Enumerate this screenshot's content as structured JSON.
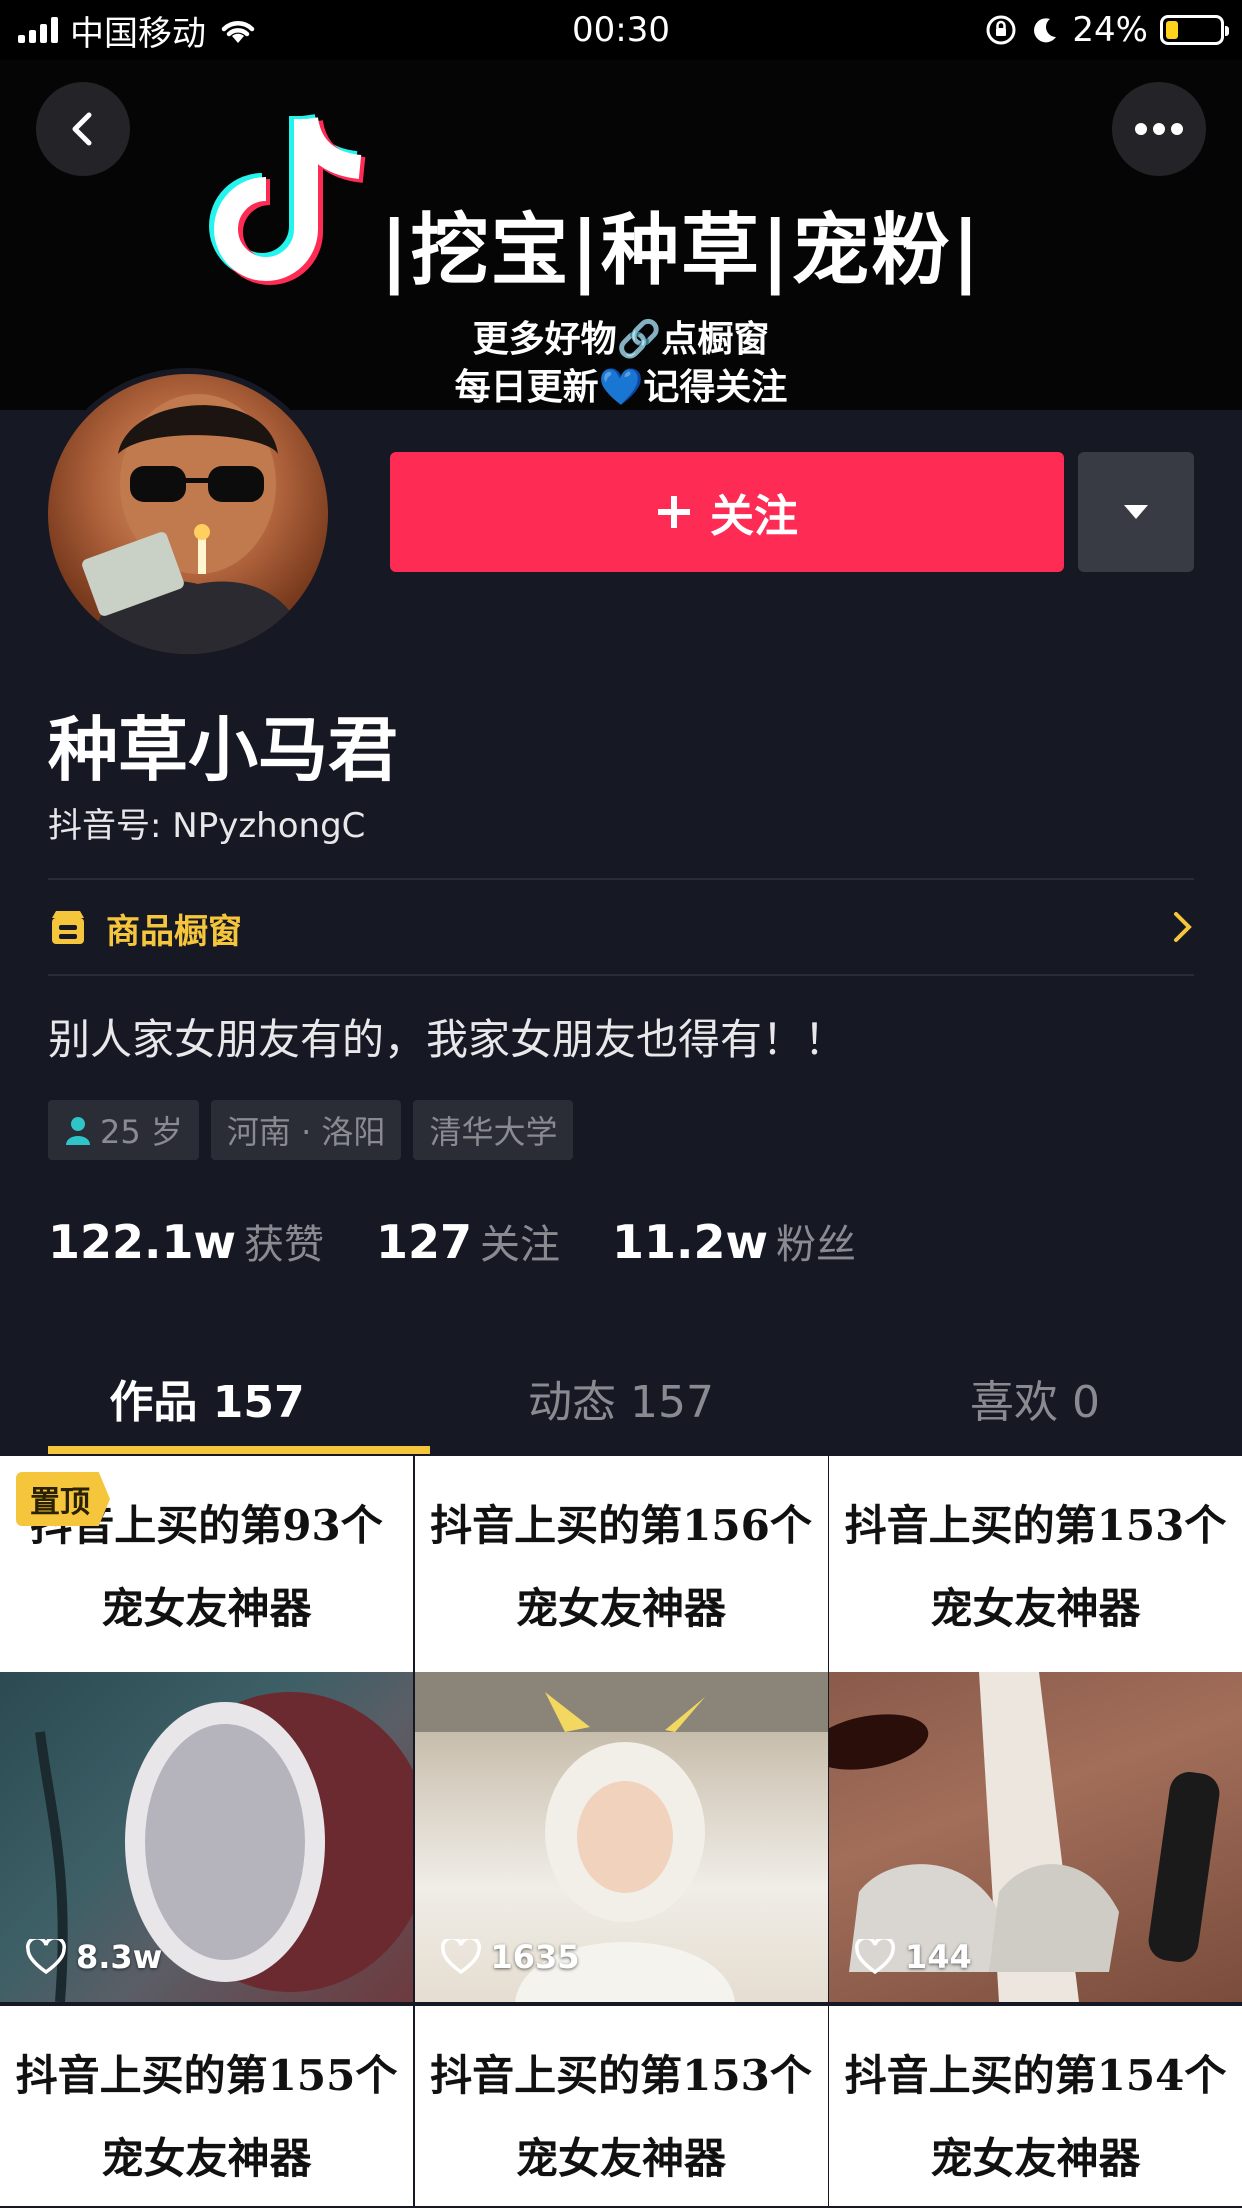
{
  "status_bar": {
    "carrier": "中国移动",
    "time": "00:30",
    "battery": "24%",
    "battery_level": 0.24
  },
  "banner": {
    "slogan": "|挖宝|种草|宠粉|",
    "line1": "更多好物🔗点橱窗",
    "line2": "每日更新💙记得关注"
  },
  "profile": {
    "follow_label": "关注",
    "nickname": "种草小马君",
    "douyin_id": "抖音号: NPyzhongC",
    "shop_label": "商品橱窗",
    "bio": "别人家女朋友有的，我家女朋友也得有！！",
    "tags": [
      "25 岁",
      "河南 · 洛阳",
      "清华大学"
    ],
    "stats": [
      {
        "num": "122.1w",
        "label": "获赞"
      },
      {
        "num": "127",
        "label": "关注"
      },
      {
        "num": "11.2w",
        "label": "粉丝"
      }
    ]
  },
  "tabs": [
    {
      "label": "作品 157",
      "active": true
    },
    {
      "label": "动态 157",
      "active": false
    },
    {
      "label": "喜欢 0",
      "active": false
    }
  ],
  "videos": [
    {
      "line1": "抖音上买的第93个",
      "line2": "宠女友神器",
      "likes": "8.3w",
      "pinned": "置顶"
    },
    {
      "line1": "抖音上买的第156个",
      "line2": "宠女友神器",
      "likes": "1635"
    },
    {
      "line1": "抖音上买的第153个",
      "line2": "宠女友神器",
      "likes": "144"
    },
    {
      "line1": "抖音上买的第155个",
      "line2": "宠女友神器"
    },
    {
      "line1": "抖音上买的第153个",
      "line2": "宠女友神器"
    },
    {
      "line1": "抖音上买的第154个",
      "line2": "宠女友神器"
    }
  ],
  "colors": {
    "background": "#161823",
    "follow": "#fe2c55",
    "accent": "#f5c53c"
  }
}
